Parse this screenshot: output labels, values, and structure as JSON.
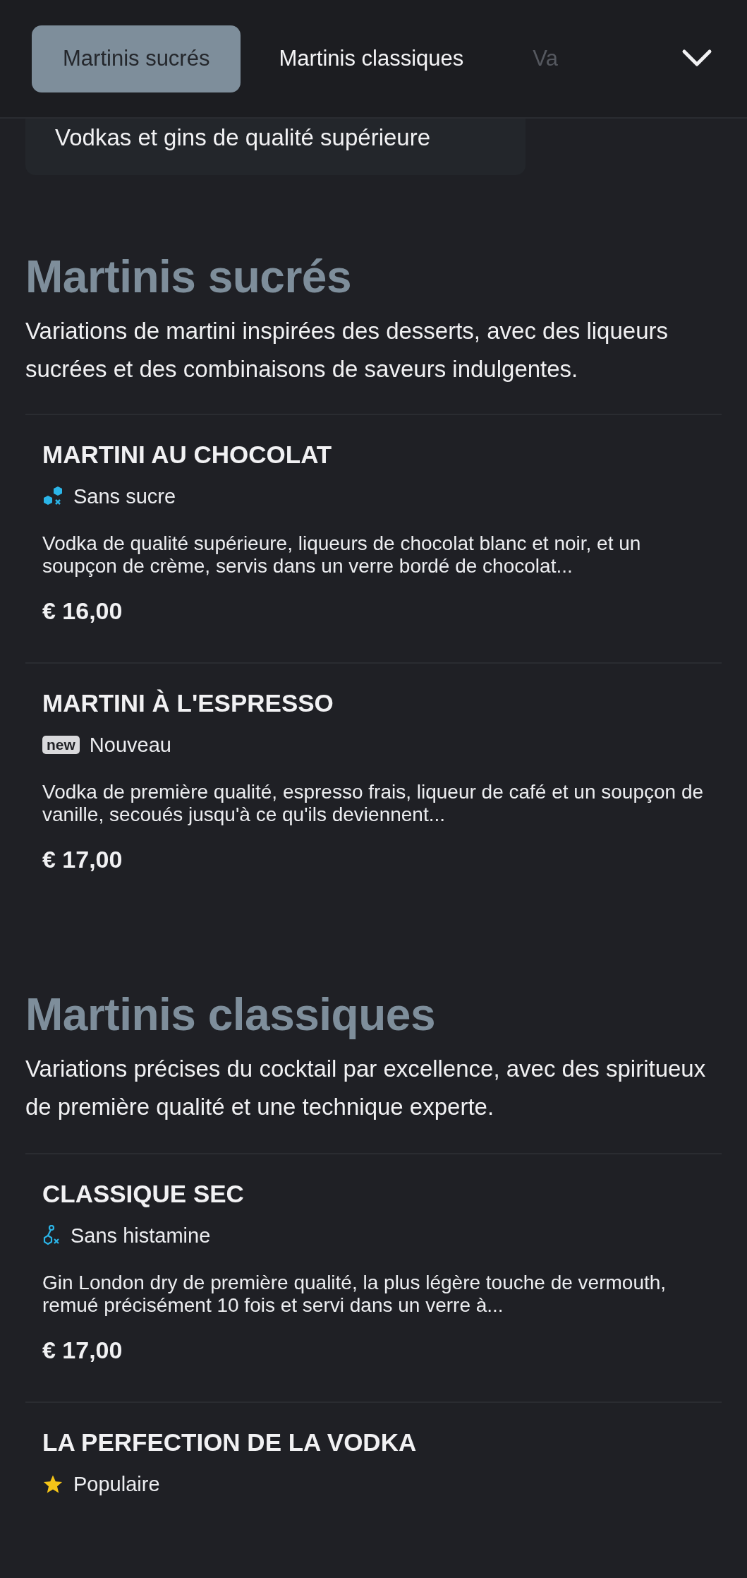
{
  "tabs": [
    {
      "label": "Martinis sucrés",
      "selected": true
    },
    {
      "label": "Martinis classiques",
      "selected": false
    },
    {
      "label": "Va",
      "selected": false
    }
  ],
  "subcategory_chip": {
    "label": "Vodkas et gins de qualité supérieure"
  },
  "sections": [
    {
      "title": "Martinis sucrés",
      "description": "Variations de martini inspirées des desserts, avec des liqueurs sucrées et des combinaisons de saveurs indulgentes.",
      "items": [
        {
          "name": "MARTINI AU CHOCOLAT",
          "tag": {
            "kind": "sugar_free",
            "label": "Sans sucre"
          },
          "description": "Vodka de qualité supérieure, liqueurs de chocolat blanc et noir, et un soupçon de crème, servis dans un verre bordé de chocolat...",
          "price": "€ 16,00"
        },
        {
          "name": "MARTINI À L'ESPRESSO",
          "tag": {
            "kind": "new",
            "badge": "new",
            "label": "Nouveau"
          },
          "description": "Vodka de première qualité, espresso frais, liqueur de café et un soupçon de vanille, secoués jusqu'à ce qu'ils deviennent...",
          "price": "€ 17,00"
        }
      ]
    },
    {
      "title": "Martinis classiques",
      "description": "Variations précises du cocktail par excellence, avec des spiritueux de première qualité et une technique experte.",
      "items": [
        {
          "name": "CLASSIQUE SEC",
          "tag": {
            "kind": "histamine_free",
            "label": "Sans histamine"
          },
          "description": "Gin London dry de première qualité, la plus légère touche de vermouth, remué précisément 10 fois et servi dans un verre à...",
          "price": "€ 17,00"
        },
        {
          "name": "LA PERFECTION DE LA VODKA",
          "tag": {
            "kind": "popular",
            "label": "Populaire"
          }
        }
      ]
    }
  ]
}
